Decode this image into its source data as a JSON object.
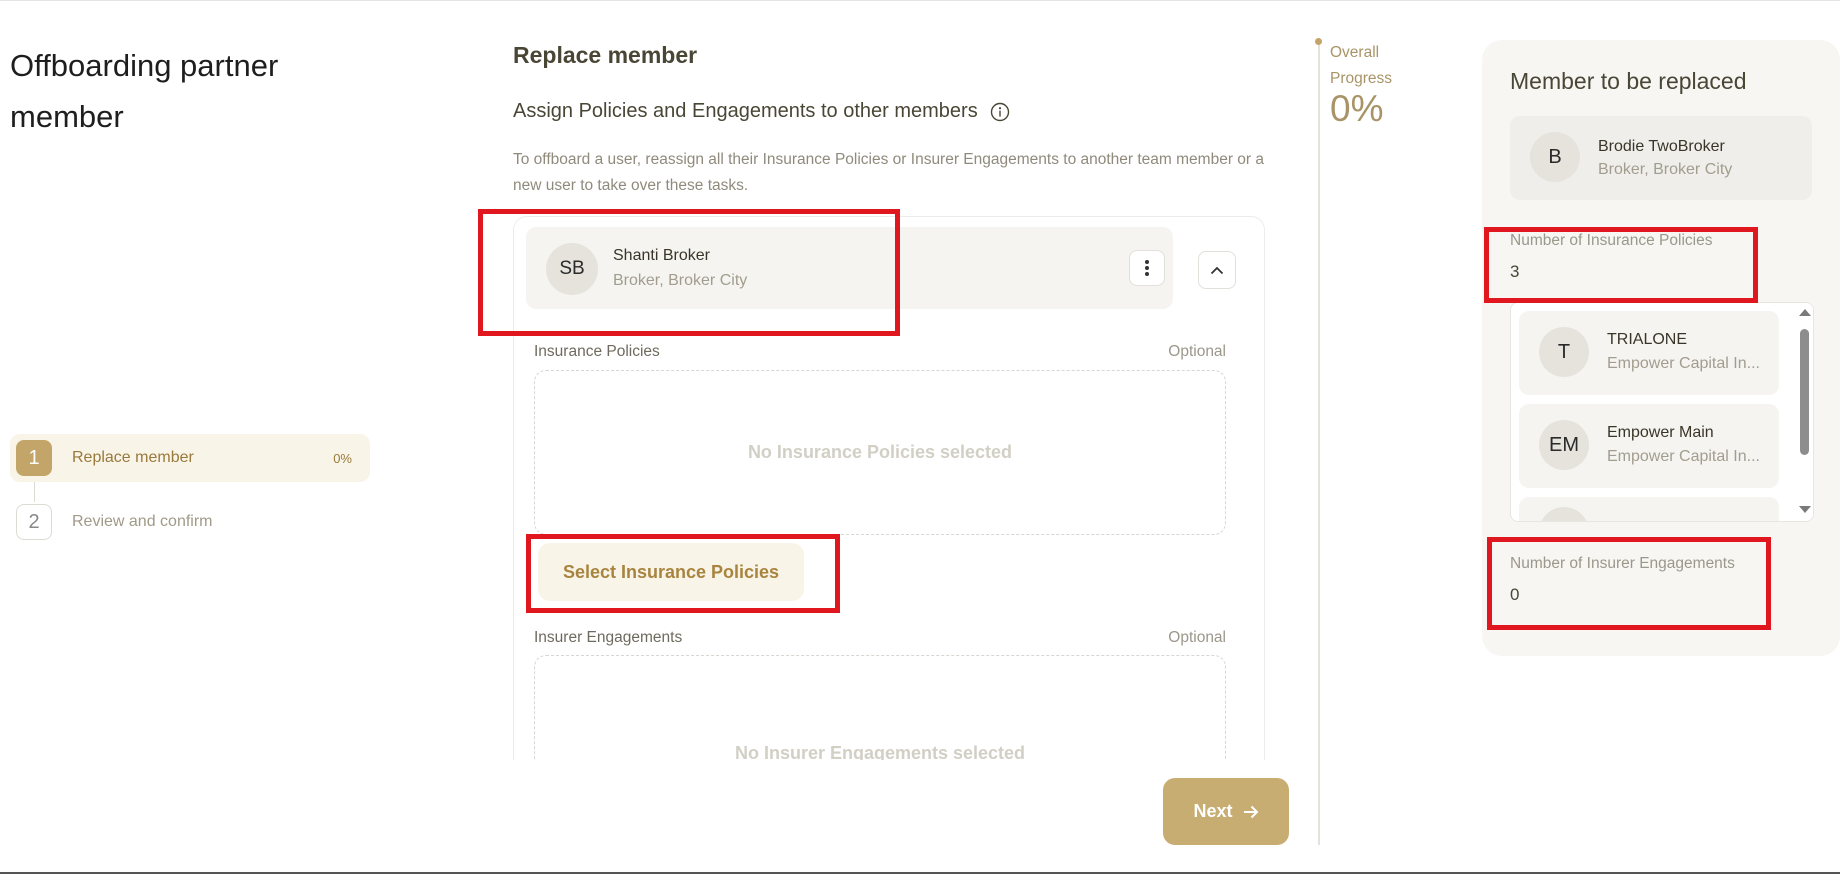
{
  "page": {
    "title": "Offboarding partner member"
  },
  "steps": [
    {
      "num": "1",
      "label": "Replace member",
      "pct": "0%"
    },
    {
      "num": "2",
      "label": "Review and confirm"
    }
  ],
  "main": {
    "heading": "Replace member",
    "subheading": "Assign Policies and Engagements to other members",
    "description": "To offboard a user, reassign all their Insurance Policies or Insurer Engagements to another team member or a new user to take over these tasks.",
    "member": {
      "initials": "SB",
      "name": "Shanti Broker",
      "subtitle": "Broker, Broker City"
    },
    "insurance_policies": {
      "label": "Insurance Policies",
      "optional": "Optional",
      "empty": "No Insurance Policies selected",
      "select_button": "Select Insurance Policies"
    },
    "insurer_engagements": {
      "label": "Insurer Engagements",
      "optional": "Optional",
      "empty": "No Insurer Engagements selected"
    },
    "next_label": "Next"
  },
  "progress": {
    "label": "Overall Progress",
    "value": "0%"
  },
  "sidebar": {
    "title": "Member to be replaced",
    "member": {
      "initials": "B",
      "name": "Brodie TwoBroker",
      "subtitle": "Broker, Broker City"
    },
    "policies_label": "Number of Insurance Policies",
    "policies_count": "3",
    "policies": [
      {
        "initials": "T",
        "name": "TRIALONE",
        "subtitle": "Empower Capital In..."
      },
      {
        "initials": "EM",
        "name": "Empower Main",
        "subtitle": "Empower Capital In..."
      }
    ],
    "engagements_label": "Number of Insurer Engagements",
    "engagements_count": "0"
  },
  "colors": {
    "accent": "#c3a56a",
    "accent_bg": "#f8f4e7",
    "highlight": "#e0171f"
  },
  "icons": [
    "info-icon",
    "kebab-icon",
    "chevron-up-icon",
    "arrow-right-icon",
    "scroll-up-icon",
    "scroll-down-icon"
  ]
}
